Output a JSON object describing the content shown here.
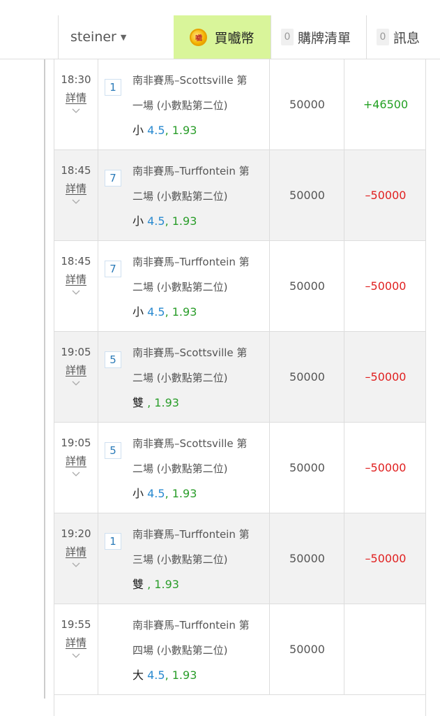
{
  "header": {
    "username": "steiner",
    "coins_label": "買嚱幣",
    "coin_icon_text": "嚱",
    "cart_count": "0",
    "cart_label": "購牌清單",
    "msg_count": "0",
    "msg_label": "訊息"
  },
  "colors": {
    "accent_green_bg": "#d9f59a",
    "win": "#22a022",
    "loss": "#e02020",
    "line_blue": "#2a8ad0",
    "odds_green": "#2a9d2a"
  },
  "rows": [
    {
      "time": "18:30",
      "detail": "詳情",
      "num": "1",
      "desc_line1": "南非賽馬–Scottsville 第",
      "desc_line2": "一場 (小數點第二位)",
      "pick": "小",
      "line": "4.5",
      "odds": "1.93",
      "stake": "50000",
      "result": "+46500",
      "result_type": "win"
    },
    {
      "time": "18:45",
      "detail": "詳情",
      "num": "7",
      "desc_line1": "南非賽馬–Turffontein 第",
      "desc_line2": "二場 (小數點第二位)",
      "pick": "小",
      "line": "4.5",
      "odds": "1.93",
      "stake": "50000",
      "result": "–50000",
      "result_type": "loss"
    },
    {
      "time": "18:45",
      "detail": "詳情",
      "num": "7",
      "desc_line1": "南非賽馬–Turffontein 第",
      "desc_line2": "二場 (小數點第二位)",
      "pick": "小",
      "line": "4.5",
      "odds": "1.93",
      "stake": "50000",
      "result": "–50000",
      "result_type": "loss"
    },
    {
      "time": "19:05",
      "detail": "詳情",
      "num": "5",
      "desc_line1": "南非賽馬–Scottsville 第",
      "desc_line2": "二場 (小數點第二位)",
      "pick": "雙",
      "line": "",
      "odds": "1.93",
      "stake": "50000",
      "result": "–50000",
      "result_type": "loss"
    },
    {
      "time": "19:05",
      "detail": "詳情",
      "num": "5",
      "desc_line1": "南非賽馬–Scottsville 第",
      "desc_line2": "二場 (小數點第二位)",
      "pick": "小",
      "line": "4.5",
      "odds": "1.93",
      "stake": "50000",
      "result": "–50000",
      "result_type": "loss"
    },
    {
      "time": "19:20",
      "detail": "詳情",
      "num": "1",
      "desc_line1": "南非賽馬–Turffontein 第",
      "desc_line2": "三場 (小數點第二位)",
      "pick": "雙",
      "line": "",
      "odds": "1.93",
      "stake": "50000",
      "result": "–50000",
      "result_type": "loss"
    },
    {
      "time": "19:55",
      "detail": "詳情",
      "num": "",
      "desc_line1": "南非賽馬–Turffontein 第",
      "desc_line2": "四場 (小數點第二位)",
      "pick": "大",
      "line": "4.5",
      "odds": "1.93",
      "stake": "50000",
      "result": "",
      "result_type": ""
    }
  ]
}
